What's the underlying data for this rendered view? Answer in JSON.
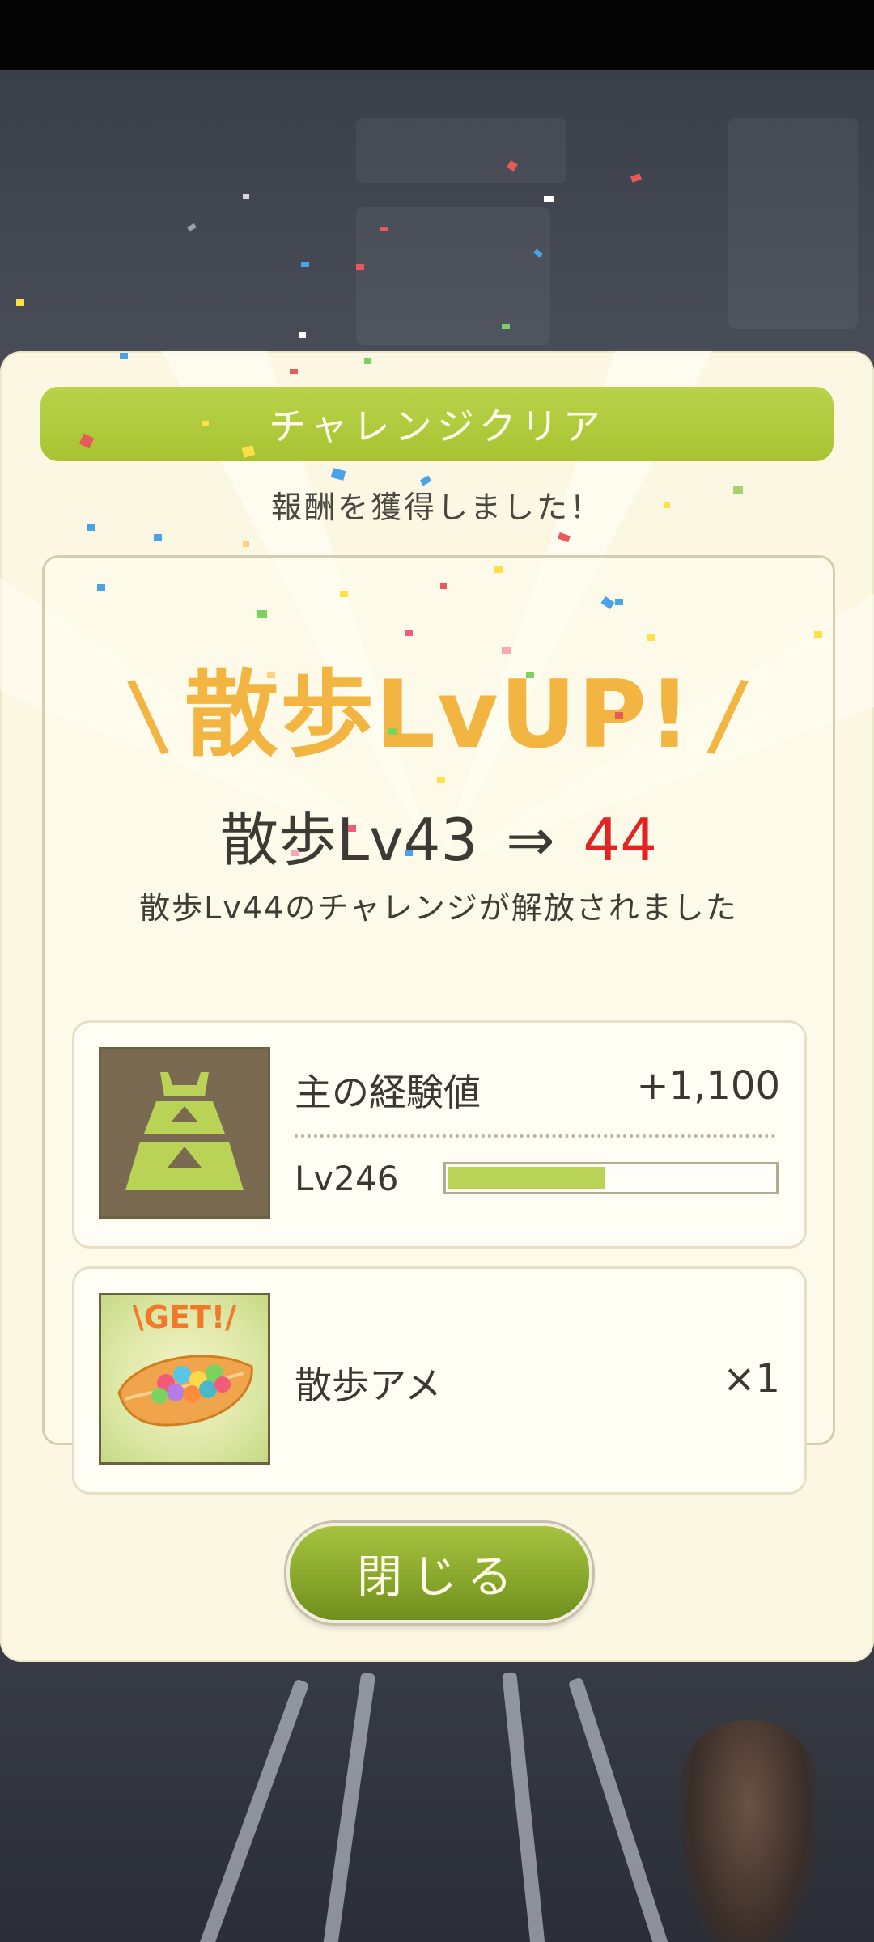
{
  "dialog": {
    "banner_title": "チャレンジクリア",
    "subtitle": "報酬を獲得しました！",
    "headline": {
      "slash_left": "\\",
      "text": "散歩LvUP!",
      "slash_right": "/"
    },
    "level_change": {
      "from": "散歩Lv43",
      "arrow": "⇒",
      "to": "44"
    },
    "unlock_message": "散歩Lv44のチャレンジが解放されました",
    "rewards": [
      {
        "icon": "castle-exp-icon",
        "name": "主の経験値",
        "value": "+1,100",
        "level_label": "Lv246",
        "progress": 0.49
      },
      {
        "icon": "walk-candy-icon",
        "badge": "\\GET!/",
        "name": "散歩アメ",
        "value": "×1"
      }
    ],
    "close_label": "閉じる"
  },
  "colors": {
    "banner": "#a9c535",
    "headline": "#f2b542",
    "level_new": "#e32222",
    "progress_fill": "#b8d355",
    "panel": "#fcf7e3"
  }
}
